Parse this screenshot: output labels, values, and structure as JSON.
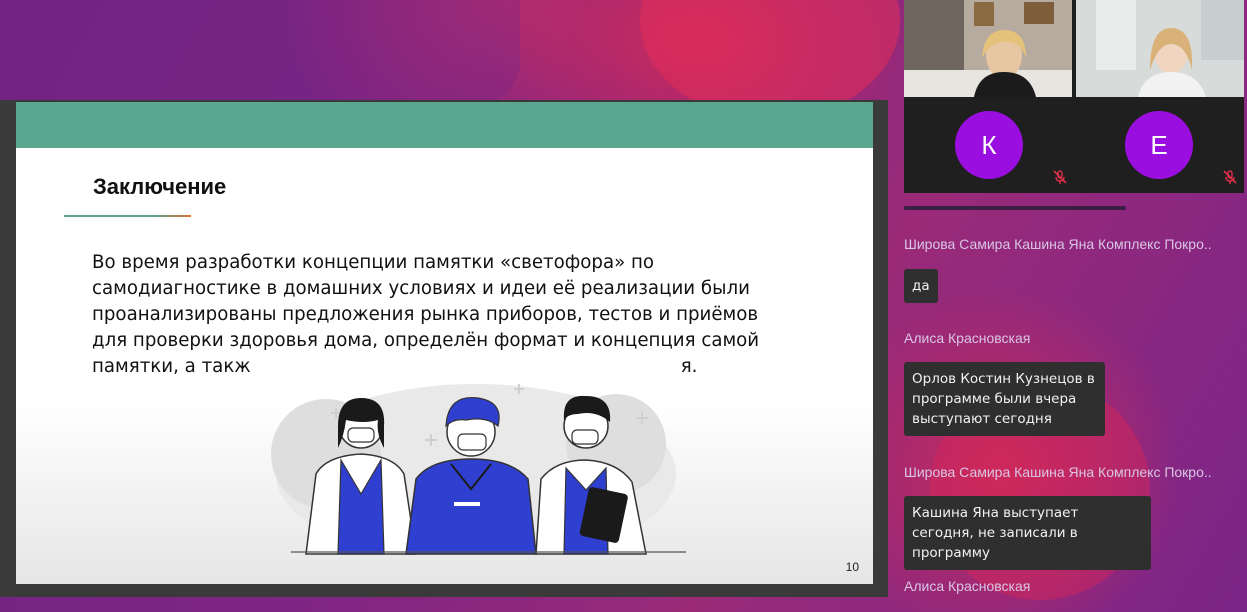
{
  "slide": {
    "title": "Заключение",
    "body": "Во время разработки концепции памятки «светофора» по самодиагностике в домашних условиях и идеи её реализации были проанализированы предложения рынка приборов, тестов и приёмов для проверки здоровья дома, определён формат и концепция самой памятки, а такж",
    "body_tail": "я.",
    "page_number": "10",
    "illustration": "doctors-illustration"
  },
  "participants": {
    "video": [
      {
        "name_hidden": true
      },
      {
        "name_hidden": true
      }
    ],
    "avatars": [
      {
        "initial": "К",
        "mic": "mic-off-icon"
      },
      {
        "initial": "Е",
        "mic": "mic-off-icon"
      }
    ]
  },
  "chat": {
    "messages": [
      {
        "author": "Широва Самира Кашина Яна Комплекс Покро..",
        "text": "да"
      },
      {
        "author": "Алиса Красновская",
        "text": "Орлов Костин Кузнецов в программе были вчера выступают сегодня"
      },
      {
        "author": "Широва Самира Кашина Яна Комплекс Покро..",
        "text": "Кашина Яна выступает сегодня, не записали в программу"
      },
      {
        "author": "Алиса Красновская",
        "text": ""
      }
    ]
  },
  "colors": {
    "slide_band": "#5aa68f",
    "avatar": "#9a0fe0",
    "scrubs": "#2f3fd0"
  }
}
